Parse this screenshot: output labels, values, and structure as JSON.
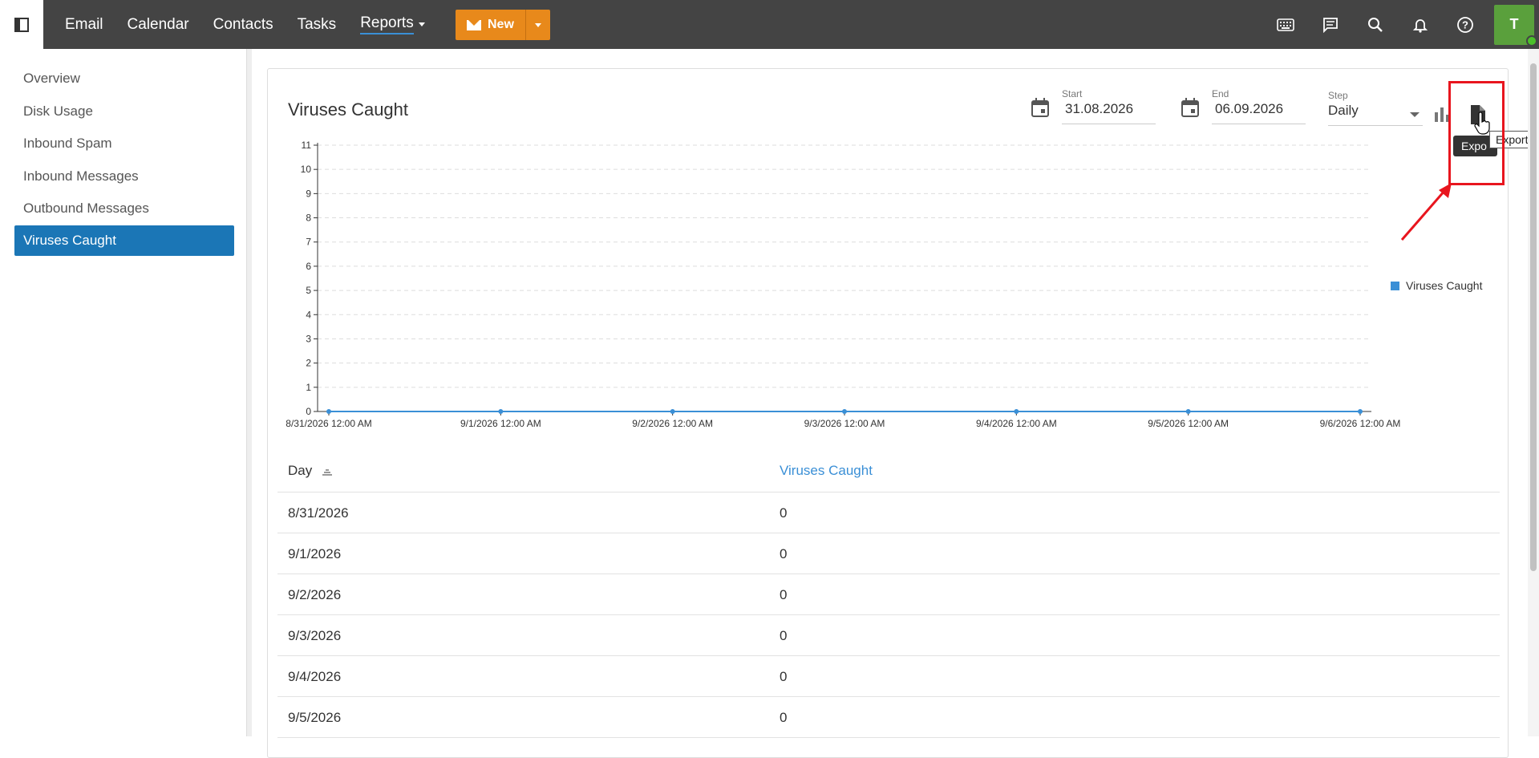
{
  "topbar": {
    "nav": [
      "Email",
      "Calendar",
      "Contacts",
      "Tasks",
      "Reports"
    ],
    "new_label": "New",
    "avatar_initial": "T"
  },
  "sidebar": {
    "items": [
      "Overview",
      "Disk Usage",
      "Inbound Spam",
      "Inbound Messages",
      "Outbound Messages",
      "Viruses Caught"
    ],
    "active": "Viruses Caught"
  },
  "report": {
    "title": "Viruses Caught",
    "start_label": "Start",
    "start_value": "31.08.2026",
    "end_label": "End",
    "end_value": "06.09.2026",
    "step_label": "Step",
    "step_value": "Daily",
    "export_tooltip_dark": "Expo",
    "export_tooltip": "Export"
  },
  "chart_data": {
    "type": "line",
    "x": [
      "8/31/2026 12:00 AM",
      "9/1/2026 12:00 AM",
      "9/2/2026 12:00 AM",
      "9/3/2026 12:00 AM",
      "9/4/2026 12:00 AM",
      "9/5/2026 12:00 AM",
      "9/6/2026 12:00 AM"
    ],
    "series": [
      {
        "name": "Viruses Caught",
        "values": [
          0,
          0,
          0,
          0,
          0,
          0,
          0
        ]
      }
    ],
    "ylim": [
      0,
      11
    ],
    "yticks": [
      0,
      1,
      2,
      3,
      4,
      5,
      6,
      7,
      8,
      9,
      10,
      11
    ],
    "grid": true,
    "legend": "right",
    "color": "#3a8fd6"
  },
  "table": {
    "headers": [
      "Day",
      "Viruses Caught"
    ],
    "rows": [
      [
        "8/31/2026",
        "0"
      ],
      [
        "9/1/2026",
        "0"
      ],
      [
        "9/2/2026",
        "0"
      ],
      [
        "9/3/2026",
        "0"
      ],
      [
        "9/4/2026",
        "0"
      ],
      [
        "9/5/2026",
        "0"
      ]
    ]
  }
}
